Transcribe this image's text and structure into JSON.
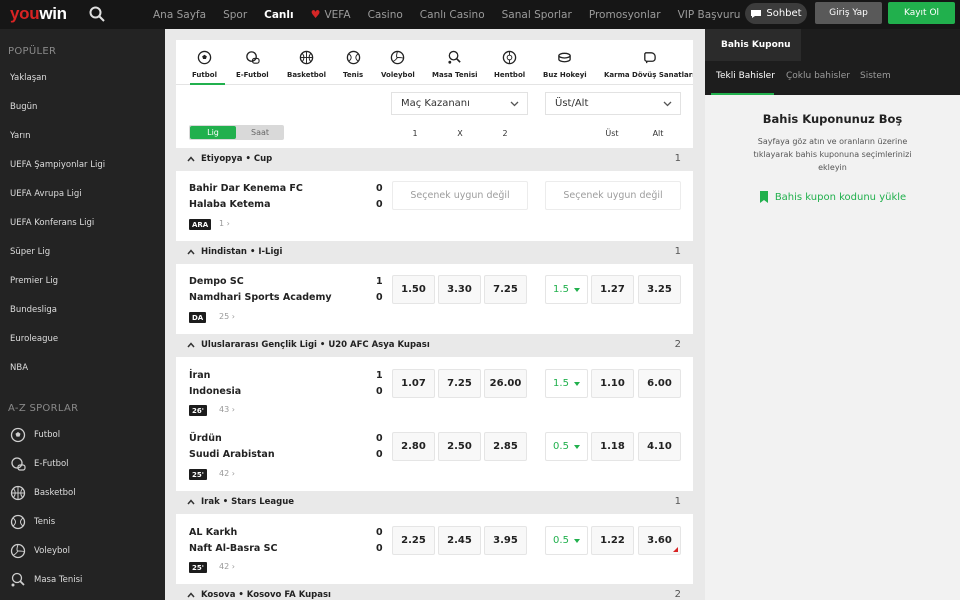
{
  "header": {
    "logo_main": "you",
    "logo_accent": "win",
    "nav": [
      "Ana Sayfa",
      "Spor",
      "Canlı",
      "VEFA",
      "Casino",
      "Canlı Casino",
      "Sanal Sporlar",
      "Promosyonlar",
      "VIP Başvuru"
    ],
    "active_nav": "Canlı",
    "chat_label": "Sohbet",
    "login_label": "Giriş Yap",
    "register_label": "Kayıt Ol"
  },
  "sidebar": {
    "popular_heading": "POPÜLER",
    "popular": [
      "Yaklaşan",
      "Bugün",
      "Yarın",
      "UEFA Şampiyonlar Ligi",
      "UEFA Avrupa Ligi",
      "UEFA Konferans Ligi",
      "Süper Lig",
      "Premier Lig",
      "Bundesliga",
      "Euroleague",
      "NBA"
    ],
    "az_heading": "A-Z SPORLAR",
    "sports": [
      {
        "label": "Futbol",
        "icon": "soccer-ball-icon"
      },
      {
        "label": "E-Futbol",
        "icon": "gamepad-icon"
      },
      {
        "label": "Basketbol",
        "icon": "basketball-icon"
      },
      {
        "label": "Tenis",
        "icon": "tennis-ball-icon"
      },
      {
        "label": "Voleybol",
        "icon": "volleyball-icon"
      },
      {
        "label": "Masa Tenisi",
        "icon": "table-tennis-icon"
      }
    ]
  },
  "sport_tabs": [
    "Futbol",
    "E-Futbol",
    "Basketbol",
    "Tenis",
    "Voleybol",
    "Masa Tenisi",
    "Hentbol",
    "Buz Hokeyi",
    "Karma Dövüş Sanatları"
  ],
  "market1": "Maç Kazananı",
  "market2": "Üst/Alt",
  "toggle": {
    "on": "Lig",
    "off": "Saat"
  },
  "col_headers": [
    "1",
    "X",
    "2",
    "Üst",
    "Alt"
  ],
  "leagues": [
    {
      "name": "Etiyopya • Cup",
      "count": "1"
    },
    {
      "name": "Hindistan • I-Ligi",
      "count": "1"
    },
    {
      "name": "Uluslararası Gençlik Ligi • U20 AFC Asya Kupası",
      "count": "2"
    },
    {
      "name": "Irak • Stars League",
      "count": "1"
    },
    {
      "name": "Kosova • Kosovo FA Kupası",
      "count": "2"
    }
  ],
  "matches": [
    {
      "home": "Bahir Dar Kenema FC",
      "away": "Halaba Ketema",
      "hs": "0",
      "as": "0",
      "badge": "ARA",
      "more": "1",
      "unavailable": "Seçenek uygun değil"
    },
    {
      "home": "Dempo SC",
      "away": "Namdhari Sports Academy",
      "hs": "1",
      "as": "0",
      "badge": "DA",
      "more": "25",
      "o1": "1.50",
      "ox": "3.30",
      "o2": "7.25",
      "line": "1.5",
      "over": "1.27",
      "under": "3.25"
    },
    {
      "home": "İran",
      "away": "Indonesia",
      "hs": "1",
      "as": "0",
      "badge": "26'",
      "more": "43",
      "o1": "1.07",
      "ox": "7.25",
      "o2": "26.00",
      "line": "1.5",
      "over": "1.10",
      "under": "6.00"
    },
    {
      "home": "Ürdün",
      "away": "Suudi Arabistan",
      "hs": "0",
      "as": "0",
      "badge": "25'",
      "more": "42",
      "o1": "2.80",
      "ox": "2.50",
      "o2": "2.85",
      "line": "0.5",
      "over": "1.18",
      "under": "4.10"
    },
    {
      "home": "AL Karkh",
      "away": "Naft Al-Basra SC",
      "hs": "0",
      "as": "0",
      "badge": "25'",
      "more": "42",
      "o1": "2.25",
      "ox": "2.45",
      "o2": "3.95",
      "line": "0.5",
      "over": "1.22",
      "under": "3.60"
    }
  ],
  "betslip": {
    "title": "Bahis Kuponu",
    "tabs": [
      "Tekli Bahisler",
      "Çoklu bahisler",
      "Sistem"
    ],
    "empty_title": "Bahis Kuponunuz Boş",
    "empty_text": "Sayfaya göz atın ve oranların üzerine tıklayarak bahis kuponuna seçimlerinizi ekleyin",
    "load_code": "Bahis kupon kodunu yükle"
  },
  "colors": {
    "brand_red": "#d82323",
    "accent_green": "#21b04d",
    "dark": "#161616"
  }
}
